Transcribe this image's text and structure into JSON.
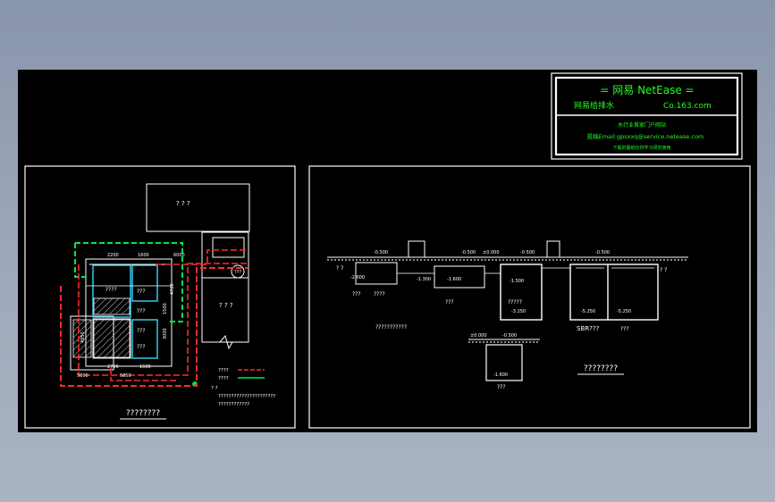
{
  "title_block": {
    "line1": "=   网易 NetEase   =",
    "left_label": "网易给排水",
    "right_label": "Co.163.com",
    "subtitle": "水行业首家门户网站",
    "email": "投稿Email:gpsxxq@service.netease.com",
    "note": "下载的图纸仅供学习研究使用"
  },
  "left_plan": {
    "title": "????????",
    "top_box_label": "? ? ?",
    "right_box_label": "? ? ?",
    "room_labels": [
      "????",
      "???",
      "???",
      "???",
      "???"
    ],
    "circle_label": "???",
    "dims_top": [
      "2200",
      "1600",
      "6000"
    ],
    "dims_bottom": [
      "5800",
      "2700",
      "5850",
      "1600"
    ],
    "dims_side": [
      "4700",
      "1500",
      "4950",
      "3000"
    ],
    "legend": [
      {
        "text": "????",
        "color": "#ff3030"
      },
      {
        "text": "????",
        "color": "#00ff60"
      }
    ],
    "notes": [
      "? ?",
      "??????????????????????",
      "????????????"
    ]
  },
  "right_section": {
    "title": "????????",
    "elevations_top": [
      "-0.500",
      "-0.500",
      "±0.000",
      "-0.500",
      "-0.500"
    ],
    "tank_labels": [
      "???",
      "????",
      "???",
      "?????",
      "SBR???",
      "???"
    ],
    "sub_title": "???????????",
    "bottom_labels": [
      "±0.000",
      "-0.500",
      "-1.600",
      "???"
    ],
    "levels": [
      "-2.600",
      "-1.300",
      "-1.600",
      "-1.500",
      "-3.250",
      "-5.250",
      "-5.250"
    ],
    "side_marks": [
      "? ?",
      "? ?"
    ]
  },
  "colors": {
    "background": "#000000",
    "line": "#ffffff",
    "red": "#ff2a2a",
    "green": "#00e84a",
    "cyan": "#30d8ff",
    "title_green": "#20ff20"
  }
}
